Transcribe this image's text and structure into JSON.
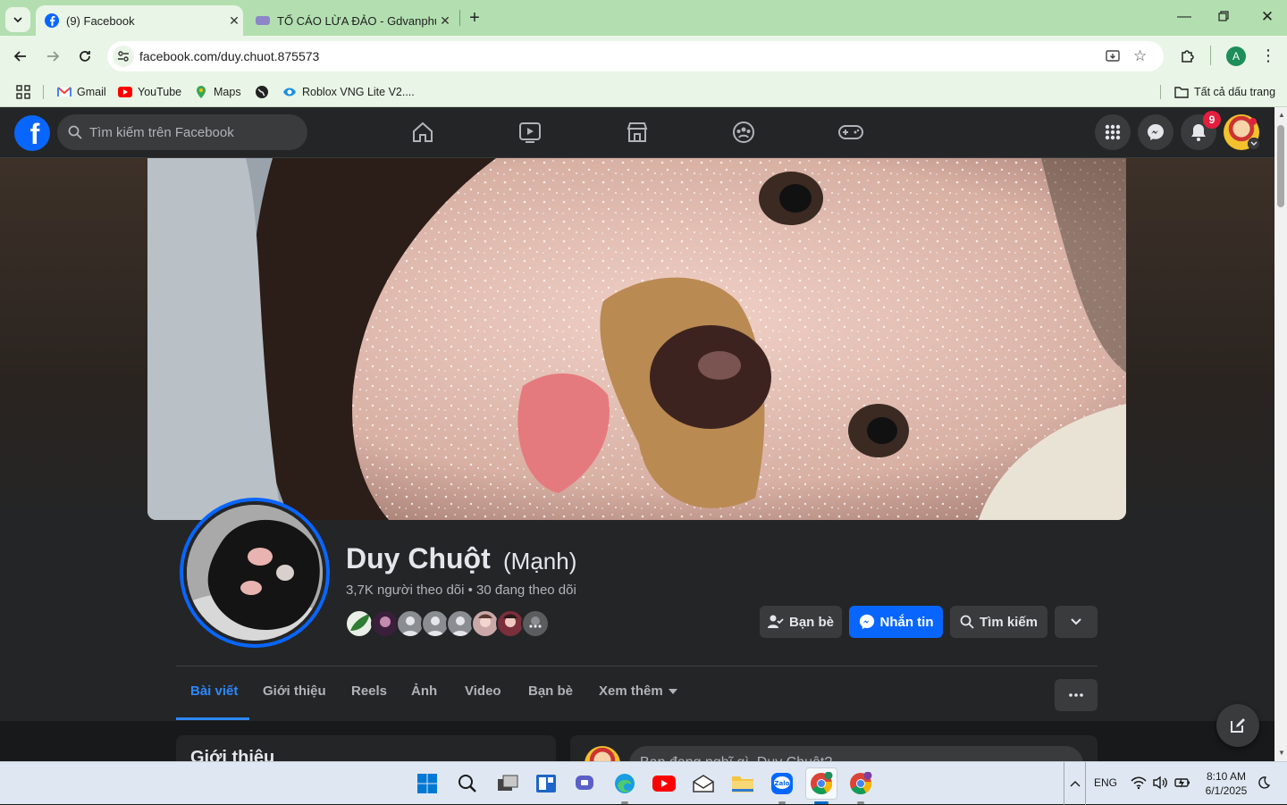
{
  "browser": {
    "tabs": [
      {
        "label": "(9) Facebook",
        "active": true
      },
      {
        "label": "TỐ CÁO LỪA ĐẢO - Gdvanphuc",
        "active": false
      }
    ],
    "url": "facebook.com/duy.chuot.875573",
    "profile_initial": "A",
    "bookmarks": [
      "Gmail",
      "YouTube",
      "Maps",
      "Roblox VNG Lite V2....",
      "Tất cả dấu trang"
    ]
  },
  "facebook": {
    "search_placeholder": "Tìm kiếm trên Facebook",
    "notification_count": "9",
    "profile": {
      "name": "Duy Chuột",
      "alternate_name": "(Mạnh)",
      "stats": "3,7K người theo dõi • 30 đang theo dõi"
    },
    "actions": {
      "friends": "Bạn bè",
      "message": "Nhắn tin",
      "search": "Tìm kiếm"
    },
    "tabs": [
      "Bài viết",
      "Giới thiệu",
      "Reels",
      "Ảnh",
      "Video",
      "Bạn bè",
      "Xem thêm"
    ],
    "intro_title": "Giới thiệu",
    "composer_placeholder": "Bạn đang nghĩ gì, Duy Chuột?"
  },
  "taskbar": {
    "language": "ENG",
    "time": "8:10 AM",
    "date": "6/1/2025"
  },
  "colors": {
    "fb_blue": "#0866ff",
    "chrome_green": "#b3dfb0"
  }
}
